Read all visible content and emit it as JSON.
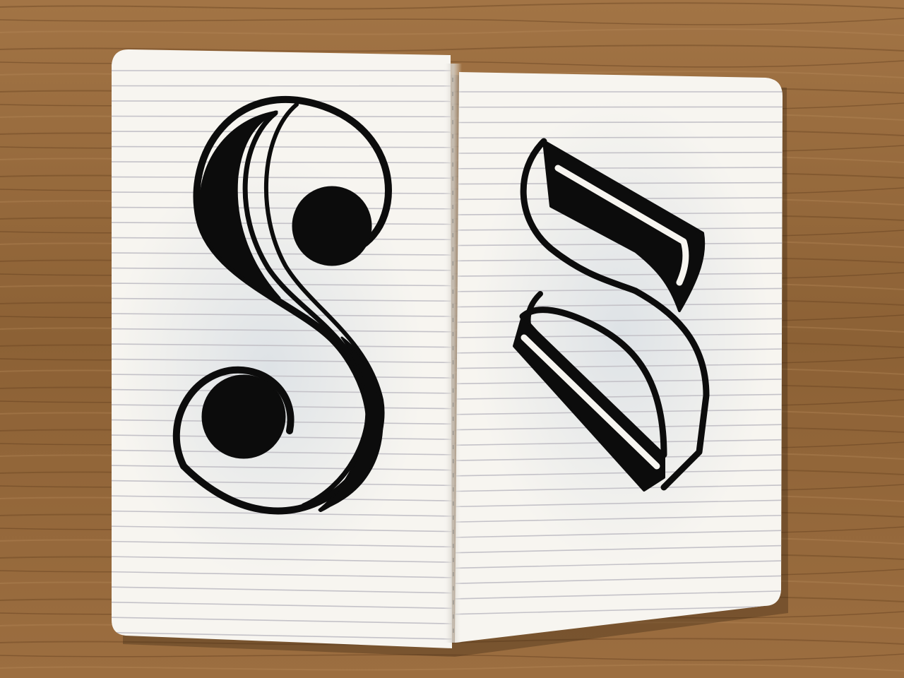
{
  "scene": {
    "subject": "open-lined-notebook",
    "surface": "wooden-table",
    "left_page_drawing": "letter-s-serif-ink-drawing",
    "right_page_drawing": "letter-s-blackletter-ink-drawing"
  },
  "colors": {
    "wood_light": "#a87a4a",
    "wood_dark": "#5e3c1e",
    "paper": "#f7f5f0",
    "rule_line": "#c4c2c8",
    "ink": "#0c0c0c",
    "bleed_through": "#cfd8e2"
  }
}
